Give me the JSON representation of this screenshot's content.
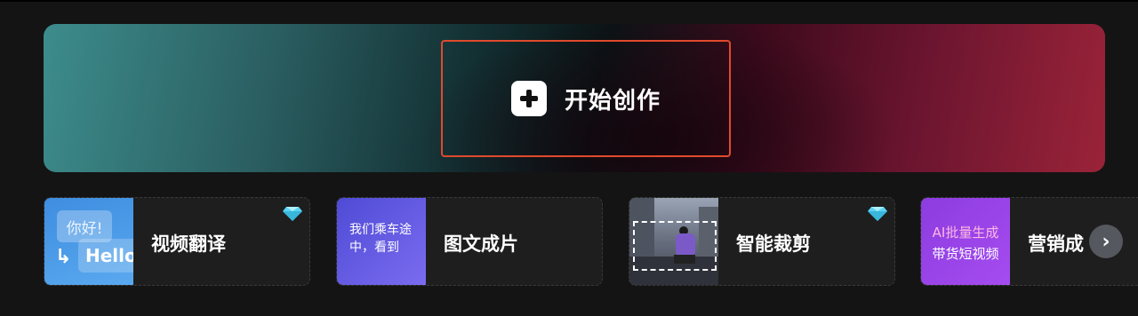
{
  "hero": {
    "create_label": "开始创作",
    "icon": "plus-square-icon",
    "border_color": "#e04a2c"
  },
  "cards": [
    {
      "label": "视频翻译",
      "premium": true,
      "thumb": {
        "bubble_top": "你好!",
        "bubble_bottom": "Hello"
      }
    },
    {
      "label": "图文成片",
      "premium": false,
      "thumb": {
        "text": "我们乘车途中，看到"
      }
    },
    {
      "label": "智能裁剪",
      "premium": true
    },
    {
      "label": "营销成",
      "premium": false,
      "thumb": {
        "line1": "AI批量生成",
        "line2": "带货短视频"
      }
    }
  ],
  "icons": {
    "gem": "diamond-icon",
    "next": "chevron-right-icon"
  },
  "colors": {
    "background": "#141414",
    "card_bg": "#1e1e1e",
    "gem": "#5fd3f3"
  }
}
